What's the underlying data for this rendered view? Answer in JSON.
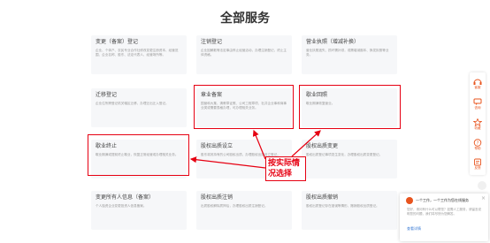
{
  "page": {
    "title": "全部服务"
  },
  "cards": [
    {
      "title": "变更（备案）登记",
      "desc": "企业、个体户、农民专业合作社修改变更注册资本、经营范围、企业名称、股东、法定代表人、经营场所等。"
    },
    {
      "title": "注销登记",
      "desc": "企业因解散等法定事由停止经营活动，办理注销登记，终止主体资格。"
    },
    {
      "title": "营业执照（增减补换）",
      "desc": "营业执照遗失、损坏需补领，或需增减副本、换发执照等业务。"
    },
    {
      "title": "迁移登记",
      "desc": "企业住所跨登记机关辖区迁移，办理迁出迁入登记。"
    },
    {
      "title": "章业备案",
      "desc": "国营和大集、清教章证照、公司工程章项、社并企业事和商事业类或需要表格办理，可办理相关业务。"
    },
    {
      "title": "歇业回照",
      "desc": "歇业期满恢复营业。"
    },
    {
      "title": "歇业终止",
      "desc": "歇业期满或提前终止歇业，恢复正常经营或办理相关业务。"
    },
    {
      "title": "股权出质设立",
      "desc": "股东将其持有的公司股权出质，办理股权出质设立登记。"
    },
    {
      "title": "股权出质变更",
      "desc": "股权出质登记事项发生变化，办理股权出质变更登记。"
    },
    {
      "title": "变更所有人信息（备案）",
      "desc": "个人独资企业变更投资人信息备案。"
    },
    {
      "title": "股权出质注销",
      "desc": "出质股权解除质押后，办理股权出质注销登记。"
    },
    {
      "title": "股权出质撤销",
      "desc": "股权出质登记存在错误等情形，撤销股权出质登记。"
    }
  ],
  "annotation": {
    "text": "按实际情况选择"
  },
  "sidebar": {
    "items": [
      {
        "label": "客服",
        "icon": "headset-icon"
      },
      {
        "label": "咨询",
        "icon": "chat-icon"
      },
      {
        "label": "收藏",
        "icon": "star-icon"
      },
      {
        "label": "帮助",
        "icon": "help-icon"
      },
      {
        "label": "反馈",
        "icon": "feedback-icon"
      }
    ]
  },
  "chat": {
    "title": "一个工作，一个工作为您在线服务",
    "body": "您好，请问有什么可以帮您？如需人工服务，请留言说明您的问题，我们将尽快为您解答。",
    "link": "查看详情"
  },
  "colors": {
    "accent": "#e60012",
    "brand": "#e8541e",
    "card_bg": "#f6f7f9"
  }
}
